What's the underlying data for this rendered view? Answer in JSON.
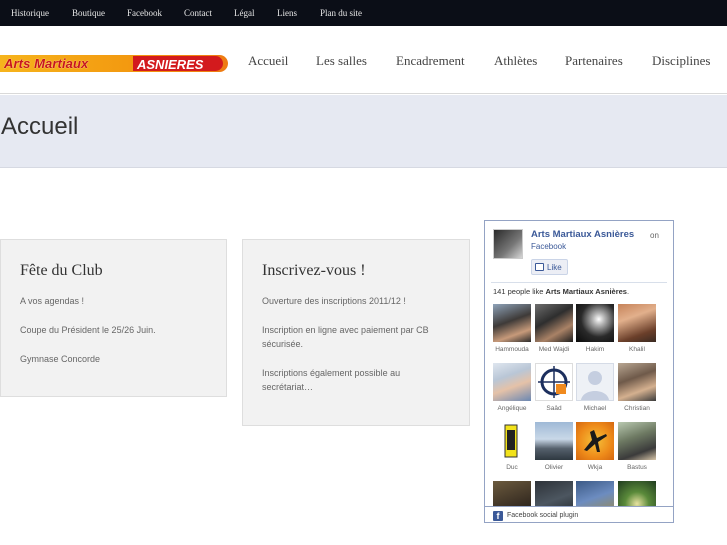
{
  "topnav": [
    "Historique",
    "Boutique",
    "Facebook",
    "Contact",
    "Légal",
    "Liens",
    "Plan du site"
  ],
  "logo": {
    "left_text": "Arts Martiaux",
    "right_text": "ASNIERES"
  },
  "mainnav": [
    "Accueil",
    "Les salles",
    "Encadrement",
    "Athlètes",
    "Partenaires",
    "Disciplines"
  ],
  "page_title": "Accueil",
  "cards": [
    {
      "title": "Fête du Club",
      "lines": [
        "A vos agendas !",
        "Coupe du Président le 25/26 Juin.",
        "Gymnase Concorde"
      ]
    },
    {
      "title": "Inscrivez-vous !",
      "lines": [
        "Ouverture des inscriptions 2011/12 !",
        "Inscription en ligne avec paiement par CB sécurisée.",
        "Inscriptions également possible au secrétariat…"
      ]
    }
  ],
  "facebook": {
    "page_name": "Arts Martiaux Asnières",
    "on": "on",
    "site": "Facebook",
    "like_label": "Like",
    "count_prefix": "141 people like ",
    "count_page": "Arts Martiaux Asnières",
    "count_suffix": ".",
    "fans": [
      "Hammouda",
      "Med Wajdi",
      "Hakim",
      "Khalil",
      "Angélique",
      "Saâd",
      "Michael",
      "Christian",
      "Duc",
      "Olivier",
      "Wkja",
      "Bastus",
      "",
      "",
      "",
      ""
    ],
    "footer": "Facebook social plugin"
  }
}
